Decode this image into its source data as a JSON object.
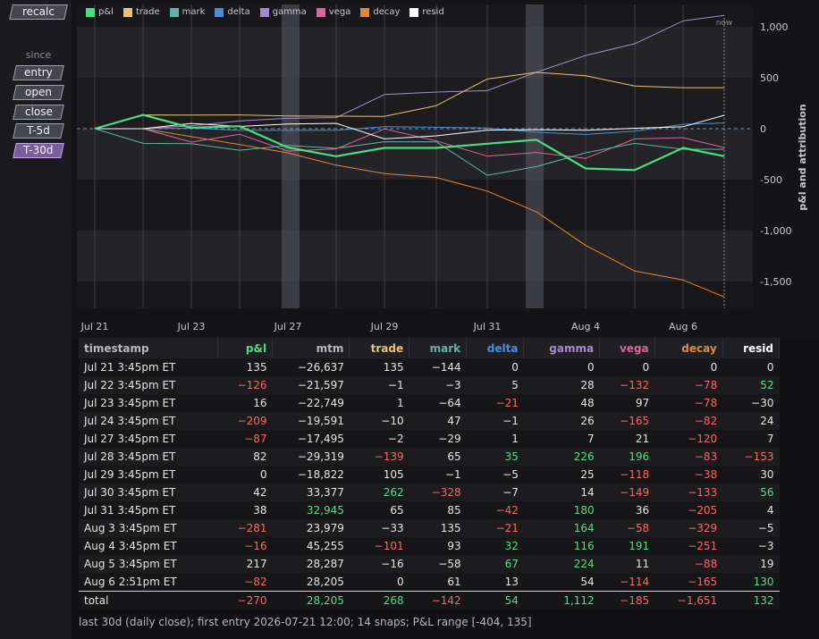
{
  "sidebar": {
    "recalc_label": "recalc",
    "since_label": "since",
    "buttons": [
      "entry",
      "open",
      "close",
      "T-5d",
      "T-30d"
    ],
    "active": "T-30d"
  },
  "colors": {
    "pnl": "#4ade80",
    "trade": "#e9c46a",
    "mark": "#5fb3a6",
    "delta": "#4a90d9",
    "gamma": "#a78bcf",
    "vega": "#d9669e",
    "decay": "#e08a3c",
    "resid": "#ffffff"
  },
  "chart_data": {
    "type": "line",
    "x": [
      "Jul 21",
      "Jul 22",
      "Jul 23",
      "Jul 24",
      "Jul 27",
      "Jul 28",
      "Jul 29",
      "Jul 30",
      "Jul 31",
      "Aug 3",
      "Aug 4",
      "Aug 5",
      "Aug 6 2:51pm",
      "Aug 6 now"
    ],
    "xticks": [
      "Jul 21",
      "Jul 23",
      "Jul 27",
      "Jul 29",
      "Jul 31",
      "Aug 4",
      "Aug 6"
    ],
    "ylim": [
      -1700,
      1100
    ],
    "yticks": [
      1000,
      500,
      0,
      -500,
      -1000,
      -1500
    ],
    "yticklabels": [
      "1,000",
      "500",
      "0",
      "-500",
      "-1,000",
      "-1,500"
    ],
    "ylabel": "p&l and attribution",
    "now_label": "now",
    "series": [
      {
        "name": "p&l",
        "key": "pnl",
        "values": [
          0,
          135,
          9,
          25,
          -184,
          -271,
          -189,
          -189,
          -147,
          -109,
          -390,
          -406,
          -189,
          -270
        ]
      },
      {
        "name": "trade",
        "key": "trade",
        "values": [
          0,
          135,
          134,
          135,
          125,
          123,
          121,
          226,
          488,
          553,
          520,
          419,
          403,
          403
        ]
      },
      {
        "name": "mark",
        "key": "mark",
        "values": [
          0,
          -144,
          -147,
          -211,
          -164,
          -193,
          -128,
          -129,
          -457,
          -372,
          -237,
          -144,
          -202,
          -202
        ]
      },
      {
        "name": "delta",
        "key": "delta",
        "values": [
          0,
          0,
          5,
          -16,
          -17,
          -16,
          19,
          14,
          7,
          -35,
          -56,
          -24,
          43,
          56
        ]
      },
      {
        "name": "gamma",
        "key": "gamma",
        "values": [
          0,
          0,
          28,
          76,
          102,
          109,
          335,
          360,
          374,
          554,
          718,
          834,
          1058,
          1112
        ]
      },
      {
        "name": "vega",
        "key": "vega",
        "values": [
          0,
          0,
          -132,
          -54,
          -219,
          -198,
          -2,
          -120,
          -269,
          -233,
          -291,
          -100,
          -89,
          -185
        ]
      },
      {
        "name": "decay",
        "key": "decay",
        "values": [
          0,
          0,
          -78,
          -156,
          -238,
          -358,
          -441,
          -479,
          -612,
          -817,
          -1146,
          -1397,
          -1485,
          -1651
        ]
      },
      {
        "name": "resid",
        "key": "resid",
        "values": [
          0,
          0,
          52,
          22,
          46,
          53,
          -100,
          -70,
          -14,
          -10,
          -15,
          4,
          19,
          132
        ]
      }
    ]
  },
  "table": {
    "columns": [
      {
        "label": "timestamp",
        "color": "#b8b8be"
      },
      {
        "label": "p&l",
        "color": "#4ade80"
      },
      {
        "label": "mtm",
        "color": "#b8b8be"
      },
      {
        "label": "trade",
        "color": "#e9c46a"
      },
      {
        "label": "mark",
        "color": "#5fb3a6"
      },
      {
        "label": "delta",
        "color": "#4a90d9"
      },
      {
        "label": "gamma",
        "color": "#a78bcf"
      },
      {
        "label": "vega",
        "color": "#d9669e"
      },
      {
        "label": "decay",
        "color": "#e08a3c"
      },
      {
        "label": "resid",
        "color": "#ffffff"
      }
    ],
    "rows": [
      [
        "Jul 21 3:45pm ET",
        "135",
        "−26,637",
        "135",
        "−144",
        "0",
        "0",
        "0",
        "0",
        "0"
      ],
      [
        "Jul 22 3:45pm ET",
        "−126",
        "−21,597",
        "−1",
        "−3",
        "5",
        "28",
        "−132",
        "−78",
        "52"
      ],
      [
        "Jul 23 3:45pm ET",
        "16",
        "−22,749",
        "1",
        "−64",
        "−21",
        "48",
        "97",
        "−78",
        "−30"
      ],
      [
        "Jul 24 3:45pm ET",
        "−209",
        "−19,591",
        "−10",
        "47",
        "−1",
        "26",
        "−165",
        "−82",
        "24"
      ],
      [
        "Jul 27 3:45pm ET",
        "−87",
        "−17,495",
        "−2",
        "−29",
        "1",
        "7",
        "21",
        "−120",
        "7"
      ],
      [
        "Jul 28 3:45pm ET",
        "82",
        "−29,319",
        "−139",
        "65",
        "35",
        "226",
        "196",
        "−83",
        "−153"
      ],
      [
        "Jul 29 3:45pm ET",
        "0",
        "−18,822",
        "105",
        "−1",
        "−5",
        "25",
        "−118",
        "−38",
        "30"
      ],
      [
        "Jul 30 3:45pm ET",
        "42",
        "33,377",
        "262",
        "−328",
        "−7",
        "14",
        "−149",
        "−133",
        "56"
      ],
      [
        "Jul 31 3:45pm ET",
        "38",
        "32,945",
        "65",
        "85",
        "−42",
        "180",
        "36",
        "−205",
        "4"
      ],
      [
        "Aug 3 3:45pm ET",
        "−281",
        "23,979",
        "−33",
        "135",
        "−21",
        "164",
        "−58",
        "−329",
        "−5"
      ],
      [
        "Aug 4 3:45pm ET",
        "−16",
        "45,255",
        "−101",
        "93",
        "32",
        "116",
        "191",
        "−251",
        "−3"
      ],
      [
        "Aug 5 3:45pm ET",
        "217",
        "28,287",
        "−16",
        "−58",
        "67",
        "224",
        "11",
        "−88",
        "19"
      ],
      [
        "Aug 6 2:51pm ET",
        "−82",
        "28,205",
        "0",
        "61",
        "13",
        "54",
        "−114",
        "−165",
        "130"
      ]
    ],
    "total": [
      "total",
      "−270",
      "28,205",
      "268",
      "−142",
      "54",
      "1,112",
      "−185",
      "−1,651",
      "132"
    ]
  },
  "footer": "last 30d (daily close); first entry 2026-07-21 12:00; 14 snaps; P&L range [-404, 135]"
}
